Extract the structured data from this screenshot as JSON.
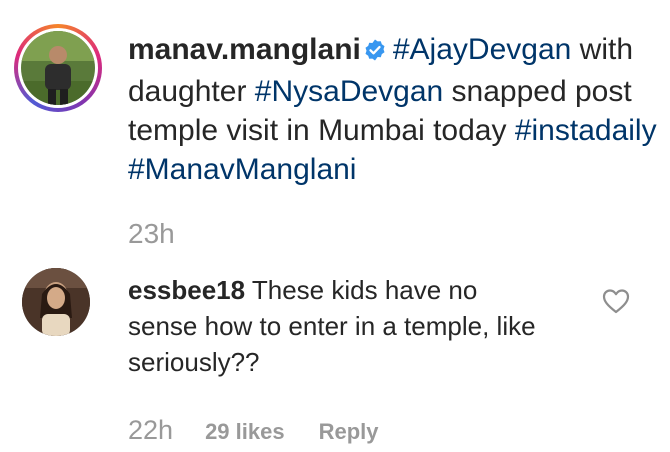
{
  "post": {
    "username": "manav.manglani",
    "caption_parts": [
      {
        "type": "tag",
        "text": "#AjayDevgan"
      },
      {
        "type": "text",
        "text": " with daughter "
      },
      {
        "type": "tag",
        "text": "#NysaDevgan"
      },
      {
        "type": "text",
        "text": " snapped post temple visit in Mumbai today "
      },
      {
        "type": "tag",
        "text": "#instadaily"
      },
      {
        "type": "text",
        "text": " "
      },
      {
        "type": "tag",
        "text": "#ManavManglani"
      }
    ],
    "time": "23h",
    "verified_icon": "verified-badge-icon"
  },
  "comment": {
    "username": "essbee18",
    "text": "These kids have no sense how to enter in a temple, like seriously??",
    "time": "22h",
    "likes": "29 likes",
    "reply_label": "Reply",
    "like_icon": "heart-outline-icon"
  },
  "colors": {
    "hashtag": "#003569",
    "muted": "#999999",
    "text": "#262626",
    "verified": "#3897f0"
  }
}
